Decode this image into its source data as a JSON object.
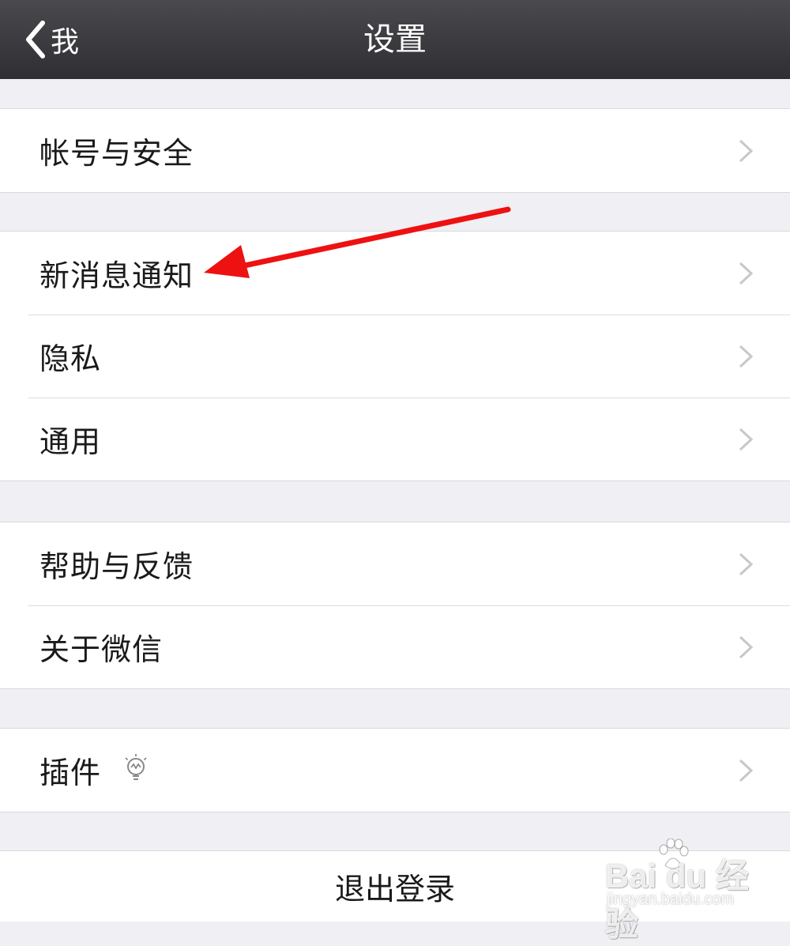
{
  "navbar": {
    "back_label": "我",
    "title": "设置"
  },
  "groups": [
    {
      "items": [
        {
          "label": "帐号与安全",
          "icon": "chevron-right-icon"
        }
      ]
    },
    {
      "items": [
        {
          "label": "新消息通知",
          "icon": "chevron-right-icon"
        },
        {
          "label": "隐私",
          "icon": "chevron-right-icon"
        },
        {
          "label": "通用",
          "icon": "chevron-right-icon"
        }
      ]
    },
    {
      "items": [
        {
          "label": "帮助与反馈",
          "icon": "chevron-right-icon"
        },
        {
          "label": "关于微信",
          "icon": "chevron-right-icon"
        }
      ]
    },
    {
      "items": [
        {
          "label": "插件",
          "badge_icon": "lightbulb-icon",
          "icon": "chevron-right-icon"
        }
      ]
    }
  ],
  "logout": {
    "label": "退出登录"
  },
  "annotation": {
    "type": "red-arrow",
    "color": "#ee1111",
    "points_to": "新消息通知"
  },
  "watermark": {
    "brand": "Bai du 经验",
    "url": "jingyan.baidu.com"
  },
  "colors": {
    "navbar": "#3a3a3e",
    "background": "#efeff4",
    "chevron": "#c7c7cc",
    "arrow": "#ee1111"
  }
}
